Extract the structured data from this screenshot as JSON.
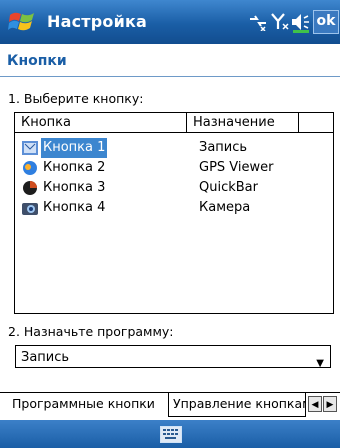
{
  "header": {
    "title": "Настройка",
    "ok_label": "ok"
  },
  "page": {
    "tab_title": "Кнопки"
  },
  "section1": {
    "label": "1. Выберите кнопку:"
  },
  "list": {
    "columns": [
      "Кнопка",
      "Назначение"
    ],
    "rows": [
      {
        "name": "Кнопка 1",
        "assignment": "Запись",
        "icon": "record-icon",
        "selected": true
      },
      {
        "name": "Кнопка 2",
        "assignment": "GPS Viewer",
        "icon": "gps-icon",
        "selected": false
      },
      {
        "name": "Кнопка 3",
        "assignment": "QuickBar",
        "icon": "quickbar-icon",
        "selected": false
      },
      {
        "name": "Кнопка 4",
        "assignment": "Камера",
        "icon": "camera-icon",
        "selected": false
      }
    ]
  },
  "section2": {
    "label": "2. Назначьте программу:"
  },
  "program": {
    "selected": "Запись"
  },
  "tabs": [
    {
      "label": "Программные кнопки",
      "active": true
    },
    {
      "label": "Управление кнопками",
      "active": false
    }
  ],
  "colors": {
    "title_bar": "#1a5ea6",
    "accent": "#1a5ea6",
    "selection": "#3c86cf"
  }
}
